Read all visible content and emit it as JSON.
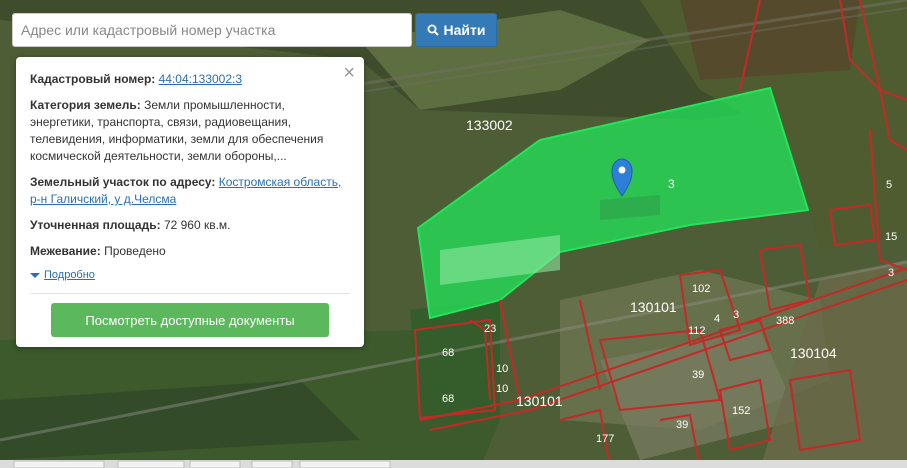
{
  "search": {
    "placeholder": "Адрес или кадастровый номер участка",
    "button_label": "Найти"
  },
  "info": {
    "cadastral_label": "Кадастровый номер:",
    "cadastral_value": "44:04:133002:3",
    "category_label": "Категория земель:",
    "category_value": "Земли промышленности, энергетики, транспорта, связи, радиовещания, телевидения, информатики, земли для обеспечения космической деятельности, земли обороны,...",
    "address_label": "Земельный участок по адресу:",
    "address_value": "Костромская область, р-н Галичский, у д.Челсма",
    "area_label": "Уточненная площадь:",
    "area_value": "72 960 кв.м.",
    "survey_label": "Межевание:",
    "survey_value": "Проведено",
    "more_label": "Подробно",
    "docs_button": "Посмотреть доступные документы",
    "close": "×"
  },
  "map": {
    "labels": {
      "q133002": "133002",
      "q130101a": "130101",
      "q130101b": "130101",
      "q130104": "130104",
      "p3": "3",
      "p102": "102",
      "p4": "4",
      "p3b": "3",
      "p112": "112",
      "p388": "388",
      "p68a": "68",
      "p68b": "68",
      "p23": "23",
      "p10a": "10",
      "p10b": "10",
      "p39a": "39",
      "p39b": "39",
      "p152": "152",
      "p177": "177",
      "p15": "15",
      "p5": "5",
      "p3c": "3"
    },
    "colors": {
      "highlight": "#22e55a",
      "boundary": "#c62828",
      "accent": "#337ab7",
      "button_green": "#5cb85c"
    },
    "marker_icon": "map-pin-icon"
  }
}
